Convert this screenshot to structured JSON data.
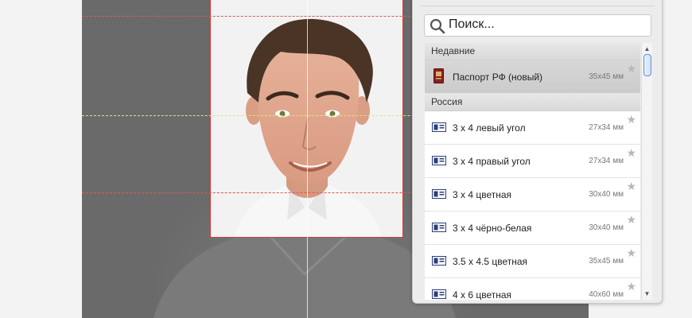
{
  "search": {
    "placeholder": "Поиск...",
    "value": ""
  },
  "groups": [
    {
      "title": "Недавние",
      "items": [
        {
          "label": "Паспорт РФ (новый)",
          "size": "35x45 мм",
          "icon": "passport-icon",
          "selected": true
        }
      ]
    },
    {
      "title": "Россия",
      "items": [
        {
          "label": "3 x 4 левый угол",
          "size": "27x34 мм",
          "icon": "photo-doc-icon"
        },
        {
          "label": "3 x 4 правый угол",
          "size": "27x34 мм",
          "icon": "photo-doc-icon"
        },
        {
          "label": "3 x 4 цветная",
          "size": "30x40 мм",
          "icon": "photo-doc-icon"
        },
        {
          "label": "3 x 4 чёрно-белая",
          "size": "30x40 мм",
          "icon": "photo-doc-icon"
        },
        {
          "label": "3.5 x 4.5 цветная",
          "size": "35x45 мм",
          "icon": "photo-doc-icon"
        },
        {
          "label": "4 x 6 цветная",
          "size": "40x60 мм",
          "icon": "photo-doc-icon"
        }
      ]
    }
  ],
  "icons": {
    "star": "★",
    "scroll_up": "▲",
    "scroll_down": "▼"
  },
  "colors": {
    "guide_red": "#e05555",
    "guide_yellow": "#e5e07a",
    "selection": "#cbcbcb",
    "scroll_thumb": "#5b8fd6"
  }
}
